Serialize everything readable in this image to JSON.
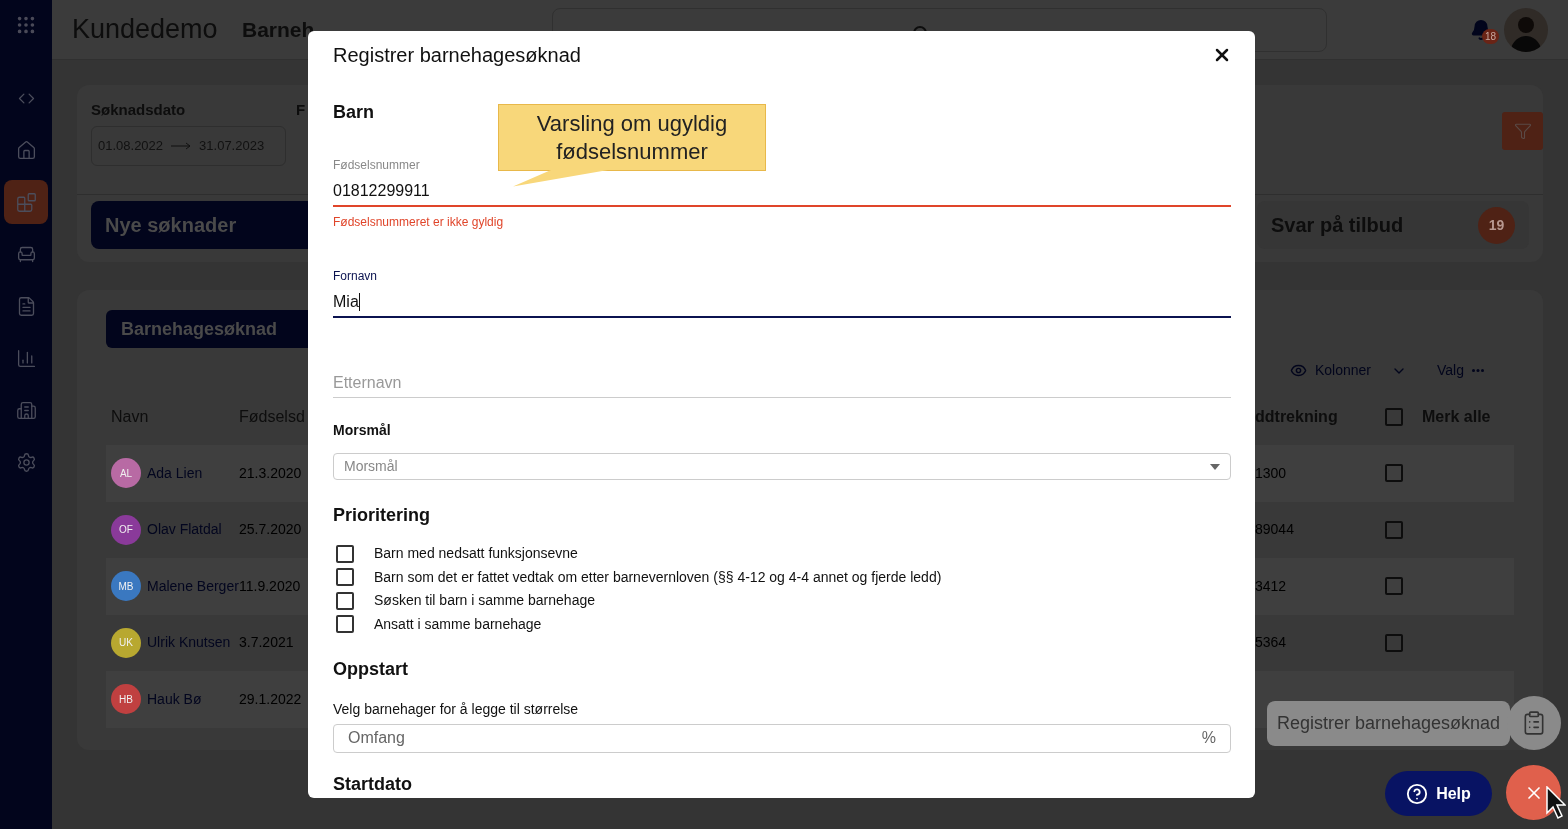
{
  "header": {
    "app": "Kundedemo",
    "module": "Barneh",
    "notifications": "18"
  },
  "sidebar": {
    "items": [
      {
        "kind": "code",
        "selected": false
      },
      {
        "kind": "home",
        "selected": false
      },
      {
        "kind": "blocks",
        "selected": true
      },
      {
        "kind": "desk",
        "selected": false
      },
      {
        "kind": "document",
        "selected": false
      },
      {
        "kind": "chart",
        "selected": false
      },
      {
        "kind": "building",
        "selected": false
      },
      {
        "kind": "settings",
        "selected": false
      }
    ]
  },
  "filters": {
    "date_label": "Søknadsdato",
    "from": "01.08.2022",
    "to": "31.07.2023",
    "label_2": "F"
  },
  "status_tabs": [
    {
      "label": "Nye søknader",
      "selected": true
    },
    {
      "label": "Svar på tilbud",
      "count": "19",
      "selected": false
    }
  ],
  "table_tab": {
    "label": "Barnehagesøknad"
  },
  "toolbar": {
    "columns": "Kolonner",
    "options": "Valg"
  },
  "table": {
    "columns": [
      "Navn",
      "Fødselsd",
      "ddtrekning",
      "Merk alle"
    ],
    "select_all_checked": false,
    "rows": [
      {
        "initials": "AL",
        "name": "Ada Lien",
        "color": "#b86aa4",
        "birth": "21.3.2020",
        "column_3": "1300",
        "checked": false
      },
      {
        "initials": "OF",
        "name": "Olav Flatdal",
        "color": "#8a3a9a",
        "birth": "25.7.2020",
        "column_3": "89044",
        "checked": false
      },
      {
        "initials": "MB",
        "name": "Malene Berger",
        "color": "#3a78c0",
        "birth": "11.9.2020",
        "column_3": "3412",
        "checked": false
      },
      {
        "initials": "UK",
        "name": "Ulrik Knutsen",
        "color": "#b8a830",
        "birth": "3.7.2021",
        "column_3": "5364",
        "checked": false
      },
      {
        "initials": "HB",
        "name": "Hauk Bø",
        "color": "#c04040",
        "birth": "29.1.2022"
      }
    ]
  },
  "dialog": {
    "title": "Registrer barnehagesøknad",
    "child_heading": "Barn",
    "fields": [
      {
        "label": "Fødselsnummer",
        "value": "01812299911",
        "error": "Fødselsnummeret er ikke gyldig",
        "focused": false
      },
      {
        "label": "Fornavn",
        "value": "Mia",
        "focused": true
      },
      {
        "placeholder": "Etternavn",
        "focused": false
      }
    ],
    "language": {
      "label": "Morsmål",
      "placeholder": "Morsmål"
    },
    "priority": {
      "heading": "Prioritering",
      "options": [
        {
          "label": "Barn med nedsatt funksjonsevne",
          "checked": false
        },
        {
          "label": "Barn som det er fattet vedtak om etter barnevernloven (§§ 4-12 og 4-4 annet og fjerde ledd)",
          "checked": false
        },
        {
          "label": "Søsken til barn i samme barnehage",
          "checked": false
        },
        {
          "label": "Ansatt i samme barnehage",
          "checked": false
        }
      ]
    },
    "start": {
      "heading": "Oppstart",
      "hint": "Velg barnehager for å legge til størrelse",
      "placeholder": "Omfang",
      "unit": "%"
    },
    "start_date_heading": "Startdato"
  },
  "annotation": {
    "text": "Varsling om ugyldig fødselsnummer"
  },
  "floating": {
    "tooltip": "Registrer barnehagesøknad",
    "help": "Help"
  }
}
